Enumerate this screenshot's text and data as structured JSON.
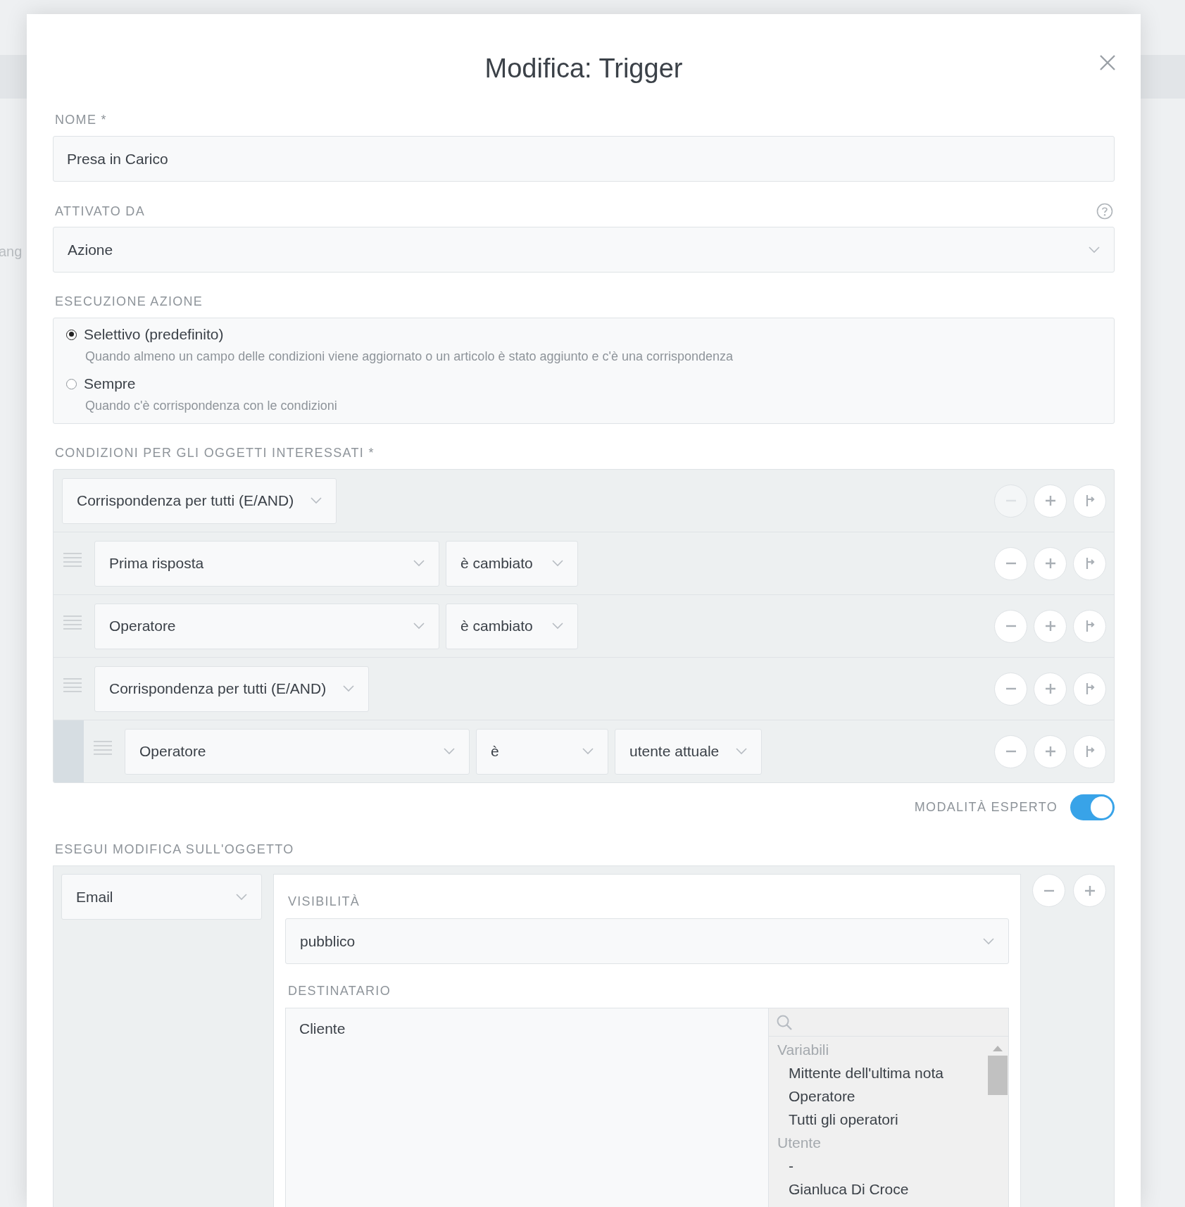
{
  "backdrop": {
    "text": "ang"
  },
  "dialog": {
    "title": "Modifica: Trigger"
  },
  "name_field": {
    "label": "NOME *",
    "value": "Presa in Carico"
  },
  "activated_by": {
    "label": "ATTIVATO DA",
    "value": "Azione"
  },
  "execution": {
    "label": "ESECUZIONE AZIONE",
    "options": [
      {
        "label": "Selettivo (predefinito)",
        "description": "Quando almeno un campo delle condizioni viene aggiornato o un articolo è stato aggiunto e c'è una corrispondenza",
        "selected": true
      },
      {
        "label": "Sempre",
        "description": "Quando c'è corrispondenza con le condizioni",
        "selected": false
      }
    ]
  },
  "conditions": {
    "label": "CONDIZIONI PER GLI OGGETTI INTERESSATI *",
    "root": {
      "selects": [
        "Corrispondenza per tutti (E/AND)"
      ],
      "removable": false,
      "children": [
        {
          "selects": [
            "Prima risposta",
            "è cambiato"
          ],
          "removable": true
        },
        {
          "selects": [
            "Operatore",
            "è cambiato"
          ],
          "removable": true
        },
        {
          "selects": [
            "Corrispondenza per tutti (E/AND)"
          ],
          "removable": true,
          "children": [
            {
              "selects": [
                "Operatore",
                "è",
                "utente attuale"
              ],
              "removable": true
            }
          ]
        }
      ]
    }
  },
  "expert_mode": {
    "label": "MODALITÀ ESPERTO",
    "on": true
  },
  "perform_change": {
    "label": "ESEGUI MODIFICA SULL'OGGETTO",
    "object": "Email",
    "visibility": {
      "label": "VISIBILITÀ",
      "value": "pubblico"
    },
    "recipient": {
      "label": "DESTINATARIO",
      "value": "Cliente",
      "groups": [
        {
          "title": "Variabili",
          "items": [
            "Mittente dell'ultima nota",
            "Operatore",
            "Tutti gli operatori"
          ]
        },
        {
          "title": "Utente",
          "items": [
            "-",
            "Gianluca Di Croce"
          ]
        }
      ]
    }
  }
}
